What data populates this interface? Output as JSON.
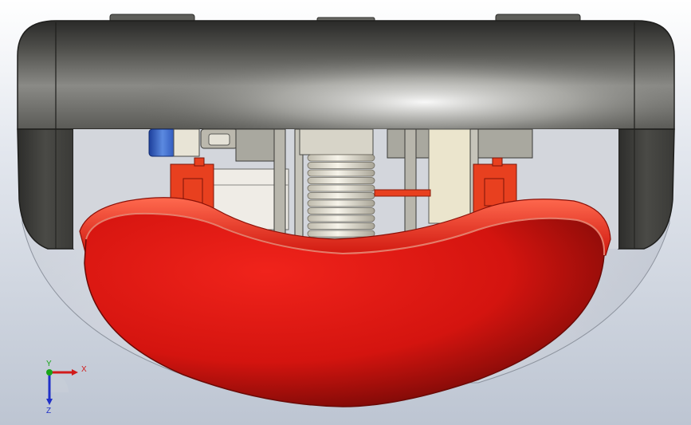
{
  "viewport": {
    "background_top": "#ffffff",
    "background_bottom": "#bdc5d2"
  },
  "model": {
    "housing_color": "#4a4a44",
    "seat_color": "#e01b14",
    "bracket_color": "#e8401f",
    "screw_color": "#ece7d8",
    "plate_color": "#ebe5cd",
    "connector_color": "#3a66c8"
  },
  "triad": {
    "x_label": "X",
    "y_label": "Y",
    "z_label": "Z",
    "x_color": "#d11a1a",
    "y_color": "#19a519",
    "z_color": "#2030c8"
  }
}
